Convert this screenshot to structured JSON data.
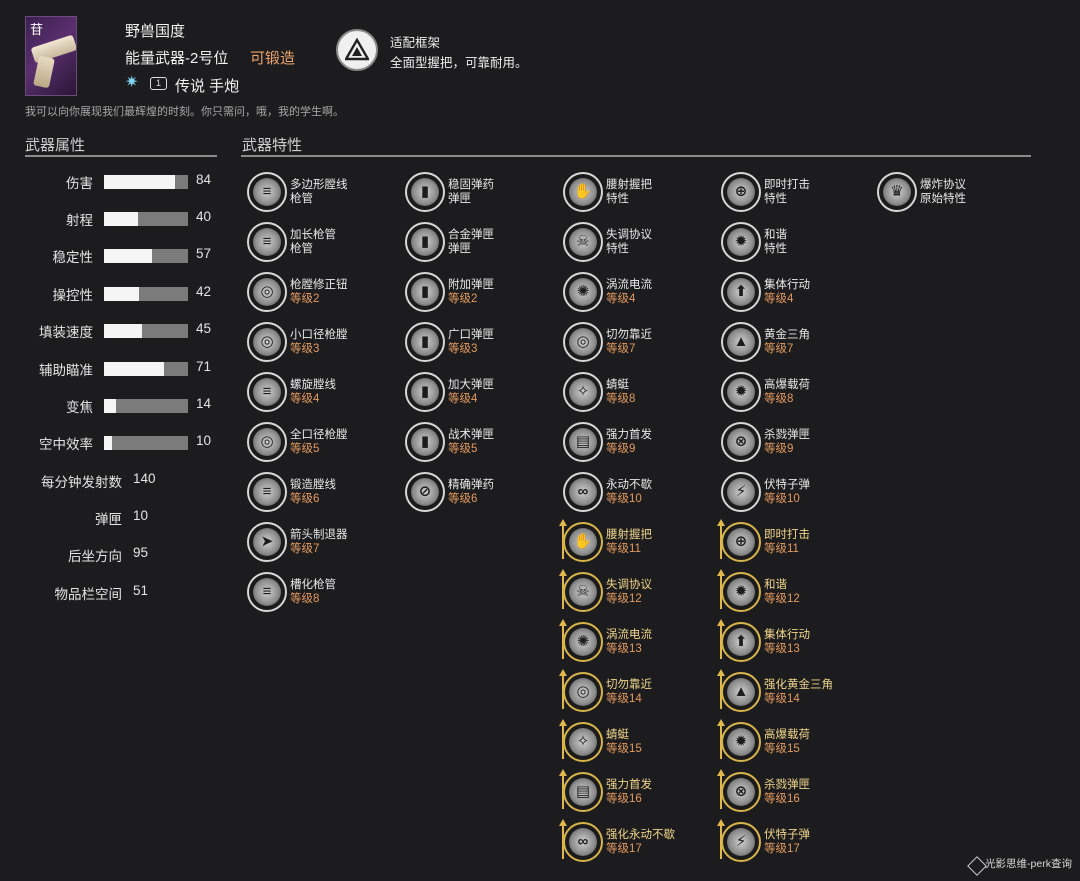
{
  "header": {
    "name": "野兽国度",
    "slot": "能量武器-2号位",
    "craftable": "可锻造",
    "ammo_badge": "1",
    "rarity_type": "传说 手炮",
    "frame_name": "适配框架",
    "frame_desc": "全面型握把，可靠耐用。",
    "flavor": "我可以向你展现我们最辉煌的时刻。你只需问，哦，我的学生啊。",
    "element_icon": "strand-icon",
    "corner_mark": "苷"
  },
  "sections": {
    "stats_title": "武器属性",
    "perks_title": "武器特性"
  },
  "stats": [
    {
      "label": "伤害",
      "value": "84",
      "fill": 0.84
    },
    {
      "label": "射程",
      "value": "40",
      "fill": 0.4
    },
    {
      "label": "稳定性",
      "value": "57",
      "fill": 0.57
    },
    {
      "label": "操控性",
      "value": "42",
      "fill": 0.42
    },
    {
      "label": "填装速度",
      "value": "45",
      "fill": 0.45
    },
    {
      "label": "辅助瞄准",
      "value": "71",
      "fill": 0.71
    },
    {
      "label": "变焦",
      "value": "14",
      "fill": 0.14
    },
    {
      "label": "空中效率",
      "value": "10",
      "fill": 0.1
    }
  ],
  "numeric_stats": [
    {
      "label": "每分钟发射数",
      "value": "140"
    },
    {
      "label": "弹匣",
      "value": "10"
    },
    {
      "label": "后坐方向",
      "value": "95"
    },
    {
      "label": "物品栏空间",
      "value": "51"
    }
  ],
  "perk_columns": [
    [
      {
        "name": "多边形膛线",
        "sub": "枪管",
        "lvl": false,
        "enh": false,
        "glyph": "≡"
      },
      {
        "name": "加长枪管",
        "sub": "枪管",
        "lvl": false,
        "enh": false,
        "glyph": "≡"
      },
      {
        "name": "枪膛修正钮",
        "sub": "等级2",
        "lvl": true,
        "enh": false,
        "glyph": "◎"
      },
      {
        "name": "小口径枪膛",
        "sub": "等级3",
        "lvl": true,
        "enh": false,
        "glyph": "◎"
      },
      {
        "name": "螺旋膛线",
        "sub": "等级4",
        "lvl": true,
        "enh": false,
        "glyph": "≡"
      },
      {
        "name": "全口径枪膛",
        "sub": "等级5",
        "lvl": true,
        "enh": false,
        "glyph": "◎"
      },
      {
        "name": "锻造膛线",
        "sub": "等级6",
        "lvl": true,
        "enh": false,
        "glyph": "≡"
      },
      {
        "name": "箭头制退器",
        "sub": "等级7",
        "lvl": true,
        "enh": false,
        "glyph": "➤"
      },
      {
        "name": "槽化枪管",
        "sub": "等级8",
        "lvl": true,
        "enh": false,
        "glyph": "≡"
      }
    ],
    [
      {
        "name": "稳固弹药",
        "sub": "弹匣",
        "lvl": false,
        "enh": false,
        "glyph": "▮"
      },
      {
        "name": "合金弹匣",
        "sub": "弹匣",
        "lvl": false,
        "enh": false,
        "glyph": "▮"
      },
      {
        "name": "附加弹匣",
        "sub": "等级2",
        "lvl": true,
        "enh": false,
        "glyph": "▮"
      },
      {
        "name": "广口弹匣",
        "sub": "等级3",
        "lvl": true,
        "enh": false,
        "glyph": "▮"
      },
      {
        "name": "加大弹匣",
        "sub": "等级4",
        "lvl": true,
        "enh": false,
        "glyph": "▮"
      },
      {
        "name": "战术弹匣",
        "sub": "等级5",
        "lvl": true,
        "enh": false,
        "glyph": "▮"
      },
      {
        "name": "精确弹药",
        "sub": "等级6",
        "lvl": true,
        "enh": false,
        "glyph": "⊘"
      }
    ],
    [
      {
        "name": "腰射握把",
        "sub": "特性",
        "lvl": false,
        "enh": false,
        "glyph": "✋"
      },
      {
        "name": "失调协议",
        "sub": "特性",
        "lvl": false,
        "enh": false,
        "glyph": "☠"
      },
      {
        "name": "涡流电流",
        "sub": "等级4",
        "lvl": true,
        "enh": false,
        "glyph": "✺"
      },
      {
        "name": "切勿靠近",
        "sub": "等级7",
        "lvl": true,
        "enh": false,
        "glyph": "◎"
      },
      {
        "name": "蜻蜓",
        "sub": "等级8",
        "lvl": true,
        "enh": false,
        "glyph": "✧"
      },
      {
        "name": "强力首发",
        "sub": "等级9",
        "lvl": true,
        "enh": false,
        "glyph": "▤"
      },
      {
        "name": "永动不歇",
        "sub": "等级10",
        "lvl": true,
        "enh": false,
        "glyph": "∞"
      },
      {
        "name": "腰射握把",
        "sub": "等级11",
        "lvl": true,
        "enh": true,
        "glyph": "✋"
      },
      {
        "name": "失调协议",
        "sub": "等级12",
        "lvl": true,
        "enh": true,
        "glyph": "☠"
      },
      {
        "name": "涡流电流",
        "sub": "等级13",
        "lvl": true,
        "enh": true,
        "glyph": "✺"
      },
      {
        "name": "切勿靠近",
        "sub": "等级14",
        "lvl": true,
        "enh": true,
        "glyph": "◎"
      },
      {
        "name": "蜻蜓",
        "sub": "等级15",
        "lvl": true,
        "enh": true,
        "glyph": "✧"
      },
      {
        "name": "强力首发",
        "sub": "等级16",
        "lvl": true,
        "enh": true,
        "glyph": "▤"
      },
      {
        "name": "强化永动不歇",
        "sub": "等级17",
        "lvl": true,
        "enh": true,
        "glyph": "∞"
      }
    ],
    [
      {
        "name": "即时打击",
        "sub": "特性",
        "lvl": false,
        "enh": false,
        "glyph": "⊕"
      },
      {
        "name": "和谐",
        "sub": "特性",
        "lvl": false,
        "enh": false,
        "glyph": "✹"
      },
      {
        "name": "集体行动",
        "sub": "等级4",
        "lvl": true,
        "enh": false,
        "glyph": "⬆"
      },
      {
        "name": "黄金三角",
        "sub": "等级7",
        "lvl": true,
        "enh": false,
        "glyph": "▲"
      },
      {
        "name": "高爆载荷",
        "sub": "等级8",
        "lvl": true,
        "enh": false,
        "glyph": "✹"
      },
      {
        "name": "杀戮弹匣",
        "sub": "等级9",
        "lvl": true,
        "enh": false,
        "glyph": "⊗"
      },
      {
        "name": "伏特子弹",
        "sub": "等级10",
        "lvl": true,
        "enh": false,
        "glyph": "⚡"
      },
      {
        "name": "即时打击",
        "sub": "等级11",
        "lvl": true,
        "enh": true,
        "glyph": "⊕"
      },
      {
        "name": "和谐",
        "sub": "等级12",
        "lvl": true,
        "enh": true,
        "glyph": "✹"
      },
      {
        "name": "集体行动",
        "sub": "等级13",
        "lvl": true,
        "enh": true,
        "glyph": "⬆"
      },
      {
        "name": "强化黄金三角",
        "sub": "等级14",
        "lvl": true,
        "enh": true,
        "glyph": "▲"
      },
      {
        "name": "高爆载荷",
        "sub": "等级15",
        "lvl": true,
        "enh": true,
        "glyph": "✹"
      },
      {
        "name": "杀戮弹匣",
        "sub": "等级16",
        "lvl": true,
        "enh": true,
        "glyph": "⊗"
      },
      {
        "name": "伏特子弹",
        "sub": "等级17",
        "lvl": true,
        "enh": true,
        "glyph": "⚡"
      }
    ],
    [
      {
        "name": "爆炸协议",
        "sub": "原始特性",
        "lvl": false,
        "enh": false,
        "glyph": "♛"
      }
    ]
  ],
  "watermark": "光影思维-perk查询"
}
